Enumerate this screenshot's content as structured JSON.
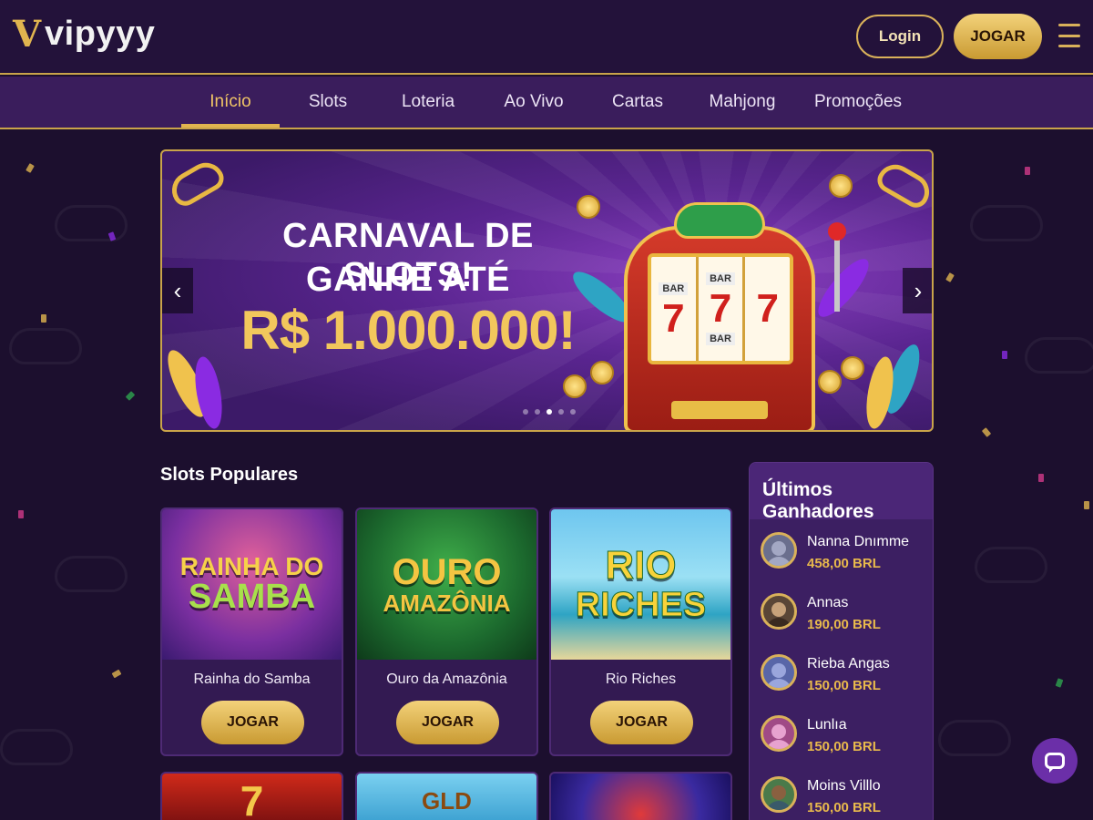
{
  "header": {
    "logo_mark": "V",
    "logo_text": "vipyyy",
    "login_label": "Login",
    "play_label": "JOGAR"
  },
  "nav": {
    "items": [
      {
        "label": "Início",
        "active": true
      },
      {
        "label": "Slots",
        "active": false
      },
      {
        "label": "Loteria",
        "active": false
      },
      {
        "label": "Ao Vivo",
        "active": false
      },
      {
        "label": "Cartas",
        "active": false
      },
      {
        "label": "Mahjong",
        "active": false
      },
      {
        "label": "Promoções",
        "active": false
      }
    ]
  },
  "hero": {
    "line1": "CARNAVAL DE SLOTS!",
    "line2": "GANHE ATÉ",
    "line3": "R$ 1.000.000!",
    "reel_top": "BAR",
    "reel_bottom": "BAR",
    "reel_symbol": "7",
    "slide_count": 5,
    "active_slide": 2
  },
  "popular": {
    "title": "Slots Populares",
    "games": [
      {
        "logo_line1": "RAINHA DO",
        "logo_line2": "SAMBA",
        "name": "Rainha do Samba",
        "button": "JOGAR"
      },
      {
        "logo_line1": "OURO",
        "logo_line2": "AMAZÔNIA",
        "name": "Ouro da Amazônia",
        "button": "JOGAR"
      },
      {
        "logo_line1": "RIO",
        "logo_line2": "RICHES",
        "name": "Rio Riches",
        "button": "JOGAR"
      }
    ],
    "row2_logos": [
      "7",
      "GLD",
      ""
    ]
  },
  "winners": {
    "title": "Últimos Ganhadores",
    "list": [
      {
        "name": "Nanna Dnımme",
        "amount": "458,00 BRL"
      },
      {
        "name": "Annas",
        "amount": "190,00 BRL"
      },
      {
        "name": "Rieba Angas",
        "amount": "150,00 BRL"
      },
      {
        "name": "Lunlıa",
        "amount": "150,00 BRL"
      },
      {
        "name": "Moins Villlo",
        "amount": "150,00 BRL"
      }
    ]
  },
  "colors": {
    "gold": "#e0b44f",
    "purple_bg": "#1c0f2e",
    "nav_bg": "#3a1d5c",
    "panel_bg": "#3c1f62"
  }
}
